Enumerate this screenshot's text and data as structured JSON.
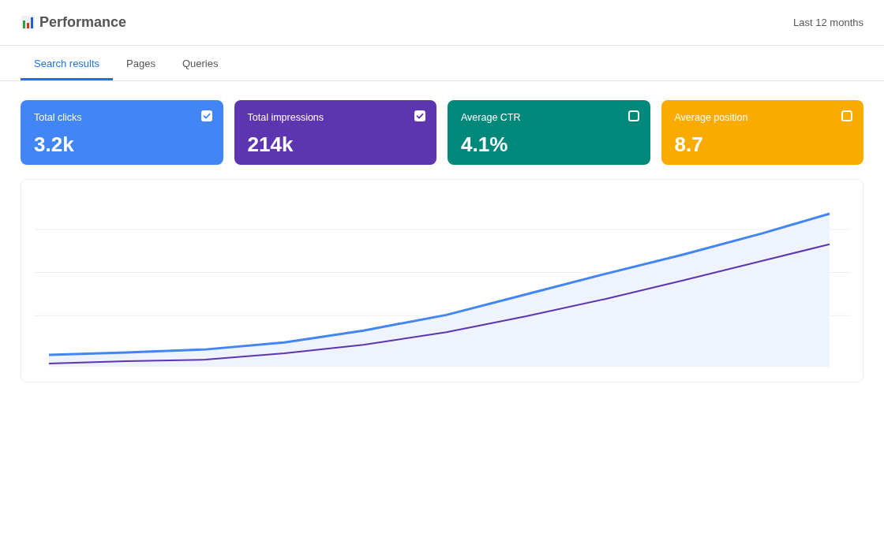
{
  "header": {
    "title": "Performance",
    "date_range": "Last 12 months"
  },
  "tabs": [
    {
      "label": "Search results",
      "selected": true
    },
    {
      "label": "Pages",
      "selected": false
    },
    {
      "label": "Queries",
      "selected": false
    }
  ],
  "cards": [
    {
      "label": "Total clicks",
      "value": "3.2k",
      "checked": true,
      "color": "#4285f4"
    },
    {
      "label": "Total impressions",
      "value": "214k",
      "checked": true,
      "color": "#5e35b1"
    },
    {
      "label": "Average CTR",
      "value": "4.1%",
      "checked": false,
      "color": "#00897b"
    },
    {
      "label": "Average position",
      "value": "8.7",
      "checked": false,
      "color": "#f9ab00"
    }
  ]
}
